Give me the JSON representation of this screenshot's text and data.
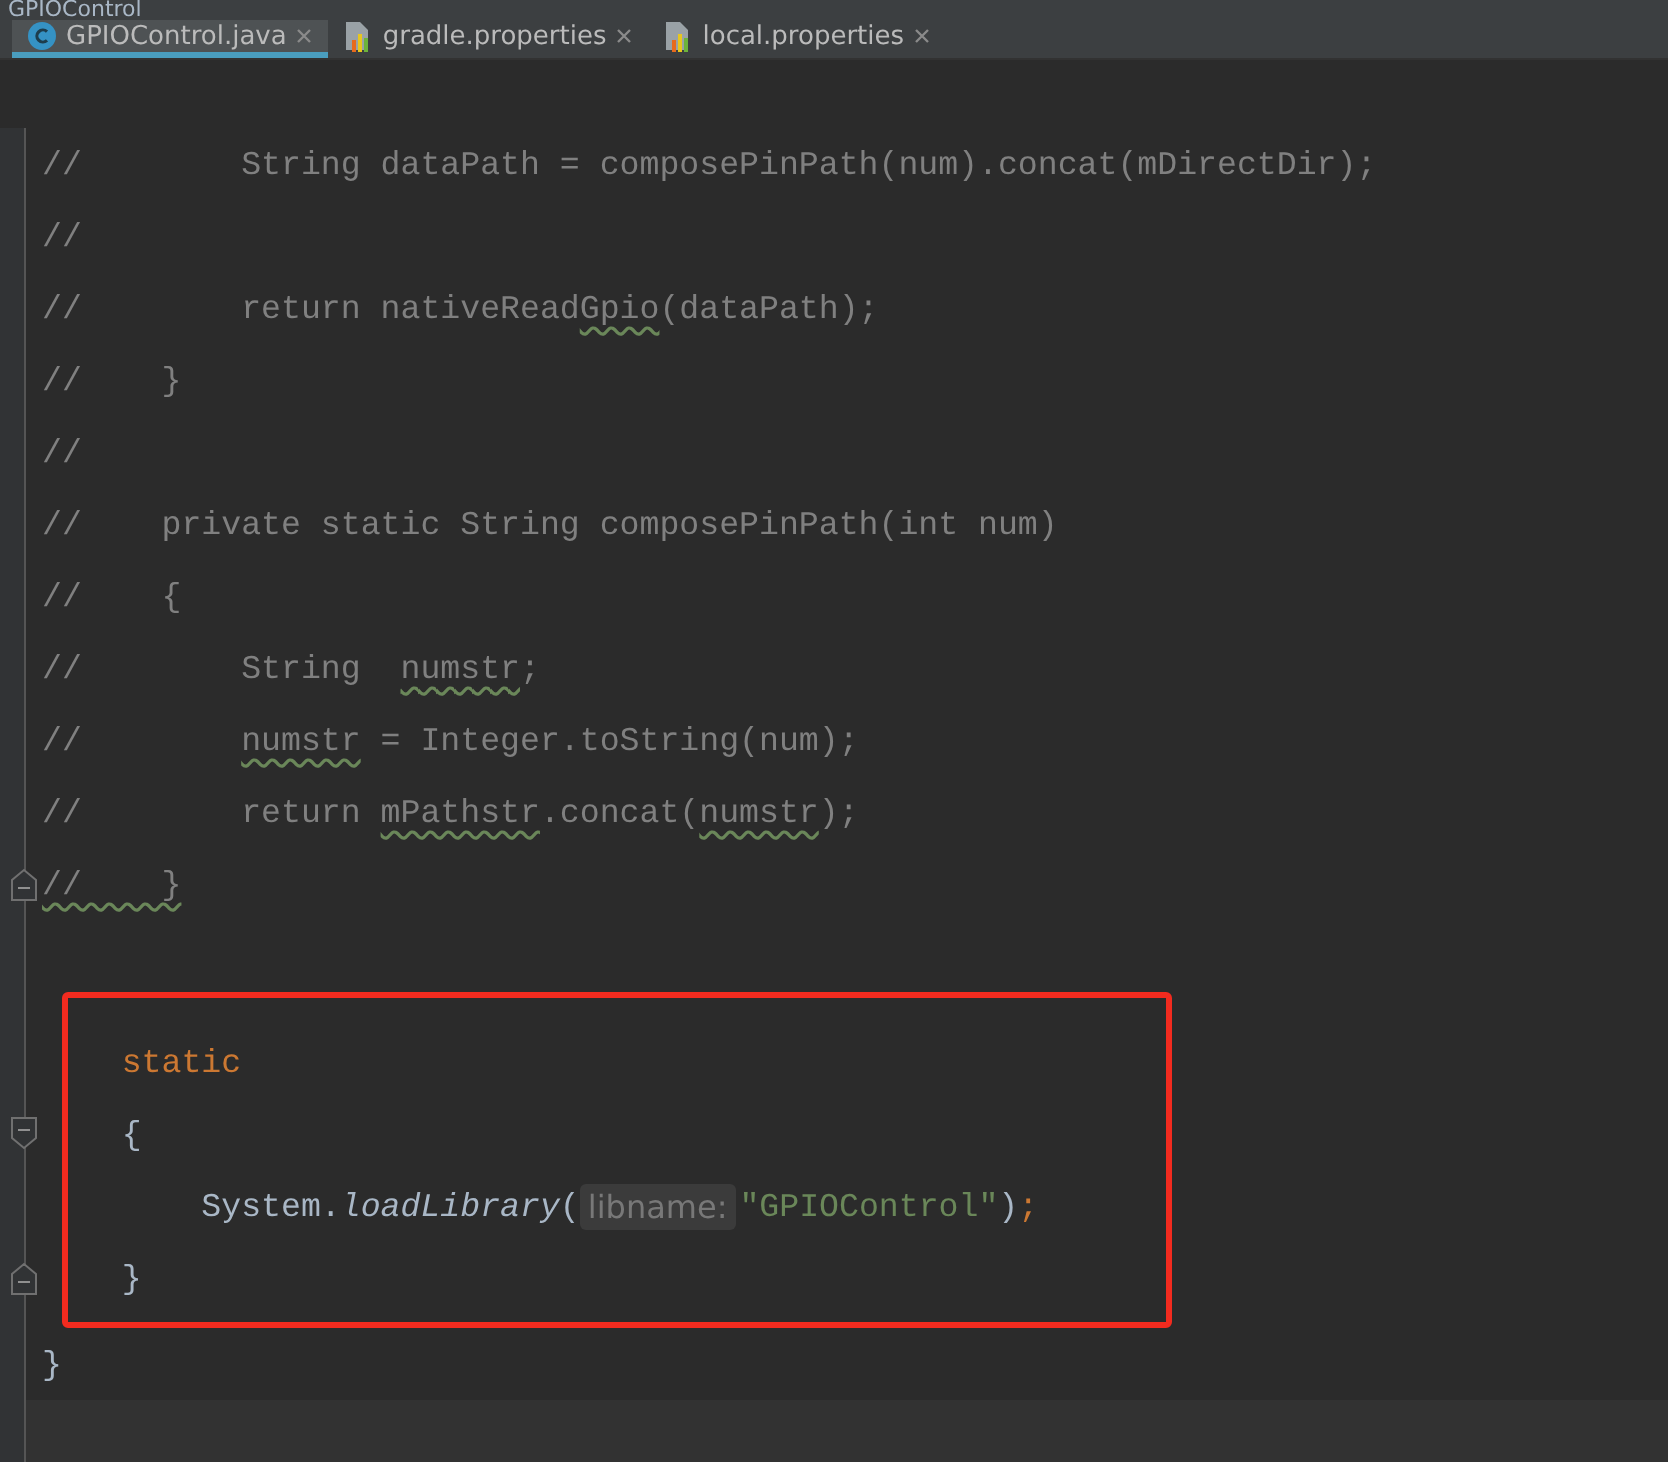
{
  "breadcrumb": "GPIOControl",
  "tabs": [
    {
      "label": "GPIOControl.java",
      "kind": "java",
      "selected": true
    },
    {
      "label": "gradle.properties",
      "kind": "properties",
      "selected": false
    },
    {
      "label": "local.properties",
      "kind": "properties",
      "selected": false
    }
  ],
  "code": {
    "blocks": [
      {
        "boxed": false,
        "lines": [
          {
            "tokens": [
              {
                "kind": "comment",
                "text": "//        String dataPath = composePinPath(num).concat(mDirectDir);"
              }
            ]
          },
          {
            "tokens": [
              {
                "kind": "comment",
                "text": "//"
              }
            ]
          },
          {
            "tokens": [
              {
                "kind": "comment",
                "text": "//        return nativeRead"
              },
              {
                "kind": "typo",
                "text": "Gpio"
              },
              {
                "kind": "comment",
                "text": "(dataPath);"
              }
            ]
          },
          {
            "tokens": [
              {
                "kind": "comment",
                "text": "//    }"
              }
            ]
          },
          {
            "tokens": [
              {
                "kind": "comment",
                "text": "//"
              }
            ]
          },
          {
            "tokens": [
              {
                "kind": "comment",
                "text": "//    private static String composePinPath(int num)"
              }
            ]
          },
          {
            "tokens": [
              {
                "kind": "comment",
                "text": "//    {"
              }
            ]
          },
          {
            "tokens": [
              {
                "kind": "comment",
                "text": "//        String  "
              },
              {
                "kind": "typo",
                "text": "numstr"
              },
              {
                "kind": "comment",
                "text": ";"
              }
            ]
          },
          {
            "tokens": [
              {
                "kind": "comment",
                "text": "//        "
              },
              {
                "kind": "typo",
                "text": "numstr"
              },
              {
                "kind": "comment",
                "text": " = Integer.toString(num);"
              }
            ]
          },
          {
            "tokens": [
              {
                "kind": "comment",
                "text": "//        return "
              },
              {
                "kind": "typo",
                "text": "mPathstr"
              },
              {
                "kind": "comment",
                "text": ".concat("
              },
              {
                "kind": "typo",
                "text": "numstr"
              },
              {
                "kind": "comment",
                "text": ");"
              }
            ]
          },
          {
            "kind": "fold_end",
            "tokens": [
              {
                "kind": "typo",
                "text": "//    }"
              }
            ]
          }
        ]
      },
      {
        "boxed": true,
        "lines": [
          {
            "tokens": [
              {
                "kind": "keyword",
                "text": "    static"
              }
            ]
          },
          {
            "kind": "fold_start",
            "tokens": [
              {
                "kind": "plain",
                "text": "    {"
              }
            ]
          },
          {
            "tokens": [
              {
                "kind": "plain",
                "text": "        System."
              },
              {
                "kind": "call",
                "text": "loadLibrary"
              },
              {
                "kind": "plain",
                "text": "("
              },
              {
                "kind": "hint",
                "text": "libname:"
              },
              {
                "kind": "string",
                "text": "\"GPIOControl\""
              },
              {
                "kind": "plain",
                "text": ")"
              },
              {
                "kind": "keyword",
                "text": ";"
              }
            ]
          },
          {
            "kind": "fold_end",
            "tokens": [
              {
                "kind": "plain",
                "text": "    }"
              }
            ]
          }
        ]
      },
      {
        "boxed": false,
        "lines": [
          {
            "tokens": [
              {
                "kind": "plain",
                "text": "}"
              }
            ]
          },
          {
            "current": true
          }
        ]
      }
    ]
  }
}
